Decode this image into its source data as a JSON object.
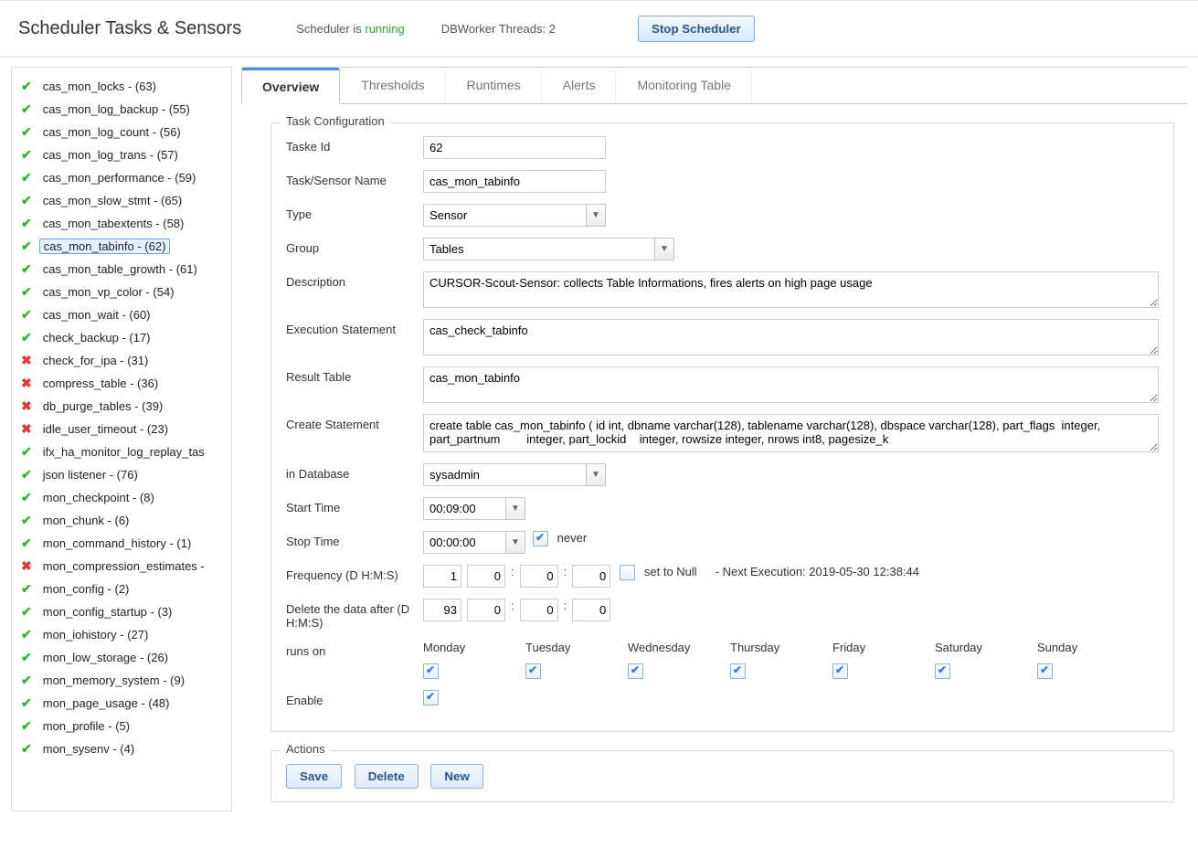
{
  "header": {
    "title": "Scheduler Tasks & Sensors",
    "status_prefix": "Scheduler is ",
    "status_value": "running",
    "db_worker": "DBWorker Threads: 2",
    "stop_button": "Stop Scheduler"
  },
  "sidebar": {
    "items": [
      {
        "status": "ok",
        "label": "cas_mon_locks - (63)"
      },
      {
        "status": "ok",
        "label": "cas_mon_log_backup - (55)"
      },
      {
        "status": "ok",
        "label": "cas_mon_log_count - (56)"
      },
      {
        "status": "ok",
        "label": "cas_mon_log_trans - (57)"
      },
      {
        "status": "ok",
        "label": "cas_mon_performance - (59)"
      },
      {
        "status": "ok",
        "label": "cas_mon_slow_stmt - (65)"
      },
      {
        "status": "ok",
        "label": "cas_mon_tabextents - (58)"
      },
      {
        "status": "ok",
        "label": "cas_mon_tabinfo - (62)",
        "selected": true
      },
      {
        "status": "ok",
        "label": "cas_mon_table_growth - (61)"
      },
      {
        "status": "ok",
        "label": "cas_mon_vp_color - (54)"
      },
      {
        "status": "ok",
        "label": "cas_mon_wait - (60)"
      },
      {
        "status": "ok",
        "label": "check_backup - (17)"
      },
      {
        "status": "fail",
        "label": "check_for_ipa - (31)"
      },
      {
        "status": "fail",
        "label": "compress_table - (36)"
      },
      {
        "status": "fail",
        "label": "db_purge_tables - (39)"
      },
      {
        "status": "fail",
        "label": "idle_user_timeout - (23)"
      },
      {
        "status": "ok",
        "label": "ifx_ha_monitor_log_replay_tas"
      },
      {
        "status": "ok",
        "label": "json listener - (76)"
      },
      {
        "status": "ok",
        "label": "mon_checkpoint - (8)"
      },
      {
        "status": "ok",
        "label": "mon_chunk - (6)"
      },
      {
        "status": "ok",
        "label": "mon_command_history - (1)"
      },
      {
        "status": "fail",
        "label": "mon_compression_estimates -"
      },
      {
        "status": "ok",
        "label": "mon_config - (2)"
      },
      {
        "status": "ok",
        "label": "mon_config_startup - (3)"
      },
      {
        "status": "ok",
        "label": "mon_iohistory - (27)"
      },
      {
        "status": "ok",
        "label": "mon_low_storage - (26)"
      },
      {
        "status": "ok",
        "label": "mon_memory_system - (9)"
      },
      {
        "status": "ok",
        "label": "mon_page_usage - (48)"
      },
      {
        "status": "ok",
        "label": "mon_profile - (5)"
      },
      {
        "status": "ok",
        "label": "mon_sysenv - (4)"
      }
    ]
  },
  "tabs": {
    "items": [
      "Overview",
      "Thresholds",
      "Runtimes",
      "Alerts",
      "Monitoring Table"
    ],
    "active": 0
  },
  "form": {
    "legend": "Task Configuration",
    "task_id_label": "Taske Id",
    "task_id": "62",
    "name_label": "Task/Sensor Name",
    "name": "cas_mon_tabinfo",
    "type_label": "Type",
    "type": "Sensor",
    "group_label": "Group",
    "group": "Tables",
    "desc_label": "Description",
    "desc": "CURSOR-Scout-Sensor: collects Table Informations, fires alerts on high page usage",
    "exec_label": "Execution Statement",
    "exec": "cas_check_tabinfo",
    "result_label": "Result Table",
    "result": "cas_mon_tabinfo",
    "create_label": "Create Statement",
    "create": "create table cas_mon_tabinfo ( id int, dbname varchar(128), tablename varchar(128), dbspace varchar(128), part_flags  integer, part_partnum        integer, part_lockid    integer, rowsize integer, nrows int8, pagesize_k",
    "db_label": "in Database",
    "db": "sysadmin",
    "start_label": "Start Time",
    "start": "00:09:00",
    "stop_label": "Stop Time",
    "stop": "00:00:00",
    "never_label": "never",
    "freq_label": "Frequency (D H:M:S)",
    "freq_d": "1",
    "freq_h": "0",
    "freq_m": "0",
    "freq_s": "0",
    "set_null_label": "set to Null",
    "next_exec": "- Next Execution: 2019-05-30 12:38:44",
    "delete_label": "Delete the data after (D H:M:S)",
    "del_d": "93",
    "del_h": "0",
    "del_m": "0",
    "del_s": "0",
    "runs_label": "runs on",
    "days": [
      "Monday",
      "Tuesday",
      "Wednesday",
      "Thursday",
      "Friday",
      "Saturday",
      "Sunday"
    ],
    "enable_label": "Enable"
  },
  "actions": {
    "legend": "Actions",
    "save": "Save",
    "delete": "Delete",
    "new": "New"
  }
}
